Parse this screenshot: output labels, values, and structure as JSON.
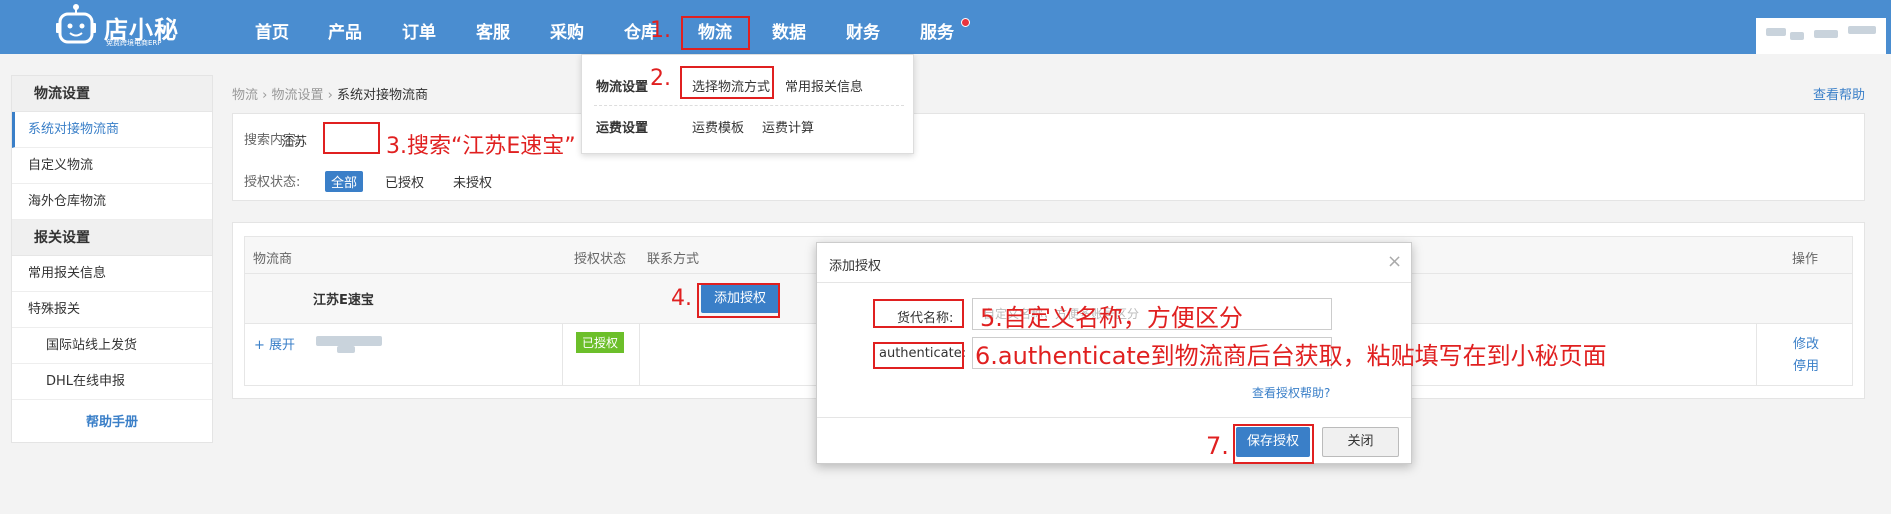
{
  "brand": {
    "name": "店小秘",
    "slogan": "免费跨境电商ERP"
  },
  "nav": [
    "首页",
    "产品",
    "订单",
    "客服",
    "采购",
    "仓库",
    "物流",
    "数据",
    "财务",
    "服务"
  ],
  "dropdown": {
    "section1": "物流设置",
    "items1": [
      "选择物流方式",
      "常用报关信息"
    ],
    "section2": "运费设置",
    "items2": [
      "运费模板",
      "运费计算"
    ]
  },
  "sidebar": {
    "head1": "物流设置",
    "items1": [
      "系统对接物流商",
      "自定义物流",
      "海外仓库物流"
    ],
    "head2": "报关设置",
    "items2": [
      "常用报关信息",
      "特殊报关"
    ],
    "sub_items": [
      "国际站线上发货",
      "DHL在线申报"
    ],
    "help": "帮助手册"
  },
  "breadcrumb": {
    "a": "物流",
    "b": "物流设置",
    "c": "系统对接物流商",
    "sep": "›"
  },
  "help_link": "查看帮助",
  "search": {
    "label": "搜索内容:",
    "value": "江苏",
    "status_label": "授权状态:",
    "status_options": [
      "全部",
      "已授权",
      "未授权"
    ]
  },
  "table": {
    "headers": [
      "物流商",
      "授权状态",
      "联系方式",
      "操作"
    ],
    "group_name": "江苏E速宝",
    "add_auth": "添加授权",
    "expand": "+ 展开",
    "status": "已授权",
    "actions": [
      "修改",
      "停用"
    ]
  },
  "modal": {
    "title": "添加授权",
    "close": "×",
    "label_name": "货代名称:",
    "placeholder_name": "自定义名称，方便多账号区分",
    "label_auth": "authenticate:",
    "help": "查看授权帮助?",
    "save": "保存授权",
    "cancel": "关闭"
  },
  "annotations": {
    "a1": "1.",
    "a2": "2.",
    "a3": "3.搜索“江苏E速宝”",
    "a4": "4.",
    "a5": "5.自定义名称，方便区分",
    "a6": "6.authenticate到物流商后台获取，粘贴填写在到小秘页面",
    "a7": "7."
  },
  "colors": {
    "topbar": "#4a8dd0",
    "primary": "#3a7fc8",
    "annotation": "#e02020",
    "success": "#6cbf2a"
  }
}
